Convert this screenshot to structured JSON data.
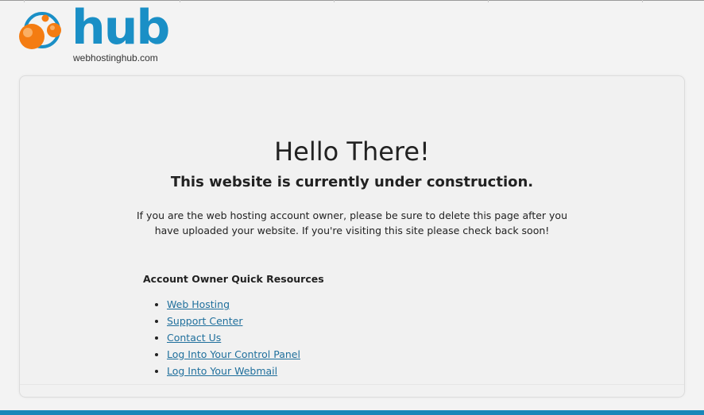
{
  "logo": {
    "word": "hub",
    "domain": "webhostinghub.com",
    "colors": {
      "orange": "#f47c12",
      "blue": "#1a8fc6"
    }
  },
  "main": {
    "title": "Hello There!",
    "subtitle": "This website is currently under construction.",
    "notice": "If you are the web hosting account owner, please be sure to delete this page after you have uploaded your website. If you're visiting this site please check back soon!"
  },
  "resources": {
    "heading": "Account Owner Quick Resources",
    "links": [
      {
        "label": "Web Hosting"
      },
      {
        "label": "Support Center"
      },
      {
        "label": "Contact Us"
      },
      {
        "label": "Log Into Your Control Panel"
      },
      {
        "label": "Log Into Your Webmail"
      }
    ]
  },
  "colors": {
    "link": "#1f6f9c",
    "bottom_bar": "#1b87b9",
    "background": "#f3f3f3"
  }
}
